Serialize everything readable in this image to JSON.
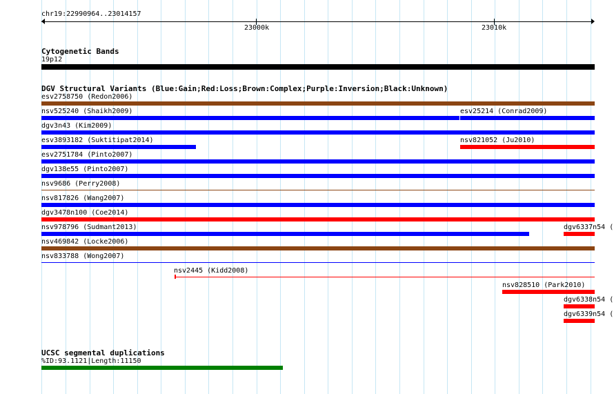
{
  "ruler": {
    "location": "chr19:22990964..23014157",
    "tick_23000k": "23000k",
    "tick_23010k": "23010k"
  },
  "cytobands": {
    "title": "Cytogenetic Bands",
    "band_label": "19p12"
  },
  "dgv": {
    "title": "DGV Structural Variants (Blue:Gain;Red:Loss;Brown:Complex;Purple:Inversion;Black:Unknown)",
    "colors": {
      "gain": "#0000ff",
      "loss": "#ff0000",
      "complex": "#8b4513",
      "unknown": "#000000"
    },
    "features": [
      {
        "id": "esv2758750",
        "label": "esv2758750 (Redon2006)",
        "type": "complex"
      },
      {
        "id": "nsv525240",
        "label": "nsv525240 (Shaikh2009)",
        "type": "gain"
      },
      {
        "id": "esv25214",
        "label": "esv25214 (Conrad2009)",
        "type": "gain"
      },
      {
        "id": "dgv3n43",
        "label": "dgv3n43 (Kim2009)",
        "type": "gain"
      },
      {
        "id": "esv3893182",
        "label": "esv3893182 (Suktitipat2014)",
        "type": "gain"
      },
      {
        "id": "nsv821052",
        "label": "nsv821052 (Ju2010)",
        "type": "loss"
      },
      {
        "id": "esv2751784",
        "label": "esv2751784 (Pinto2007)",
        "type": "gain"
      },
      {
        "id": "dgv138e55",
        "label": "dgv138e55 (Pinto2007)",
        "type": "gain"
      },
      {
        "id": "nsv9686",
        "label": "nsv9686 (Perry2008)",
        "type": "complex"
      },
      {
        "id": "nsv817826",
        "label": "nsv817826 (Wang2007)",
        "type": "gain"
      },
      {
        "id": "dgv3478n100",
        "label": "dgv3478n100 (Coe2014)",
        "type": "loss"
      },
      {
        "id": "nsv978796",
        "label": "nsv978796 (Sudmant2013)",
        "type": "gain"
      },
      {
        "id": "dgv6337n54",
        "label": "dgv6337n54 (",
        "type": "loss"
      },
      {
        "id": "nsv469842",
        "label": "nsv469842 (Locke2006)",
        "type": "complex"
      },
      {
        "id": "nsv833788",
        "label": "nsv833788 (Wong2007)",
        "type": "gain"
      },
      {
        "id": "nsv2445",
        "label": "nsv2445 (Kidd2008)",
        "type": "loss"
      },
      {
        "id": "nsv828510",
        "label": "nsv828510 (Park2010)",
        "type": "loss"
      },
      {
        "id": "dgv6338n54",
        "label": "dgv6338n54 (",
        "type": "loss"
      },
      {
        "id": "dgv6339n54",
        "label": "dgv6339n54 (",
        "type": "loss"
      }
    ]
  },
  "segdups": {
    "title": "UCSC segmental duplications",
    "feature_label": "%ID:93.1121|Length:11150",
    "color": "#008000"
  }
}
